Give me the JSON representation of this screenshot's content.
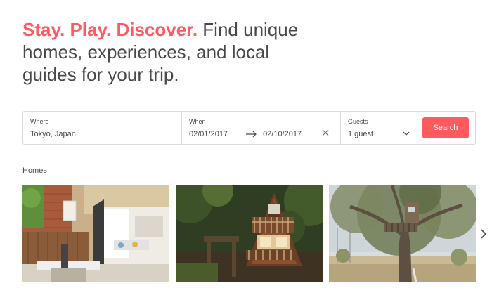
{
  "hero": {
    "accent": "Stay. Play. Discover.",
    "text": " Find unique homes, experiences, and local guides for your trip."
  },
  "search": {
    "where_label": "Where",
    "where_value": "Tokyo, Japan",
    "when_label": "When",
    "check_in": "02/01/2017",
    "check_out": "02/10/2017",
    "guests_label": "Guests",
    "guests_value": "1 guest",
    "button_label": "Search"
  },
  "homes": {
    "title": "Homes",
    "cards": [
      {
        "image": "sunlit-kitchen-patio"
      },
      {
        "image": "a-frame-cabin-woods"
      },
      {
        "image": "treehouse-oak"
      }
    ]
  },
  "icons": {
    "arrow": "arrow-right-icon",
    "clear": "close-icon",
    "chevron": "chevron-down-icon",
    "next": "chevron-right-icon"
  },
  "colors": {
    "accent": "#ff5a5f",
    "text": "#484848",
    "border": "#dbdbdb"
  }
}
